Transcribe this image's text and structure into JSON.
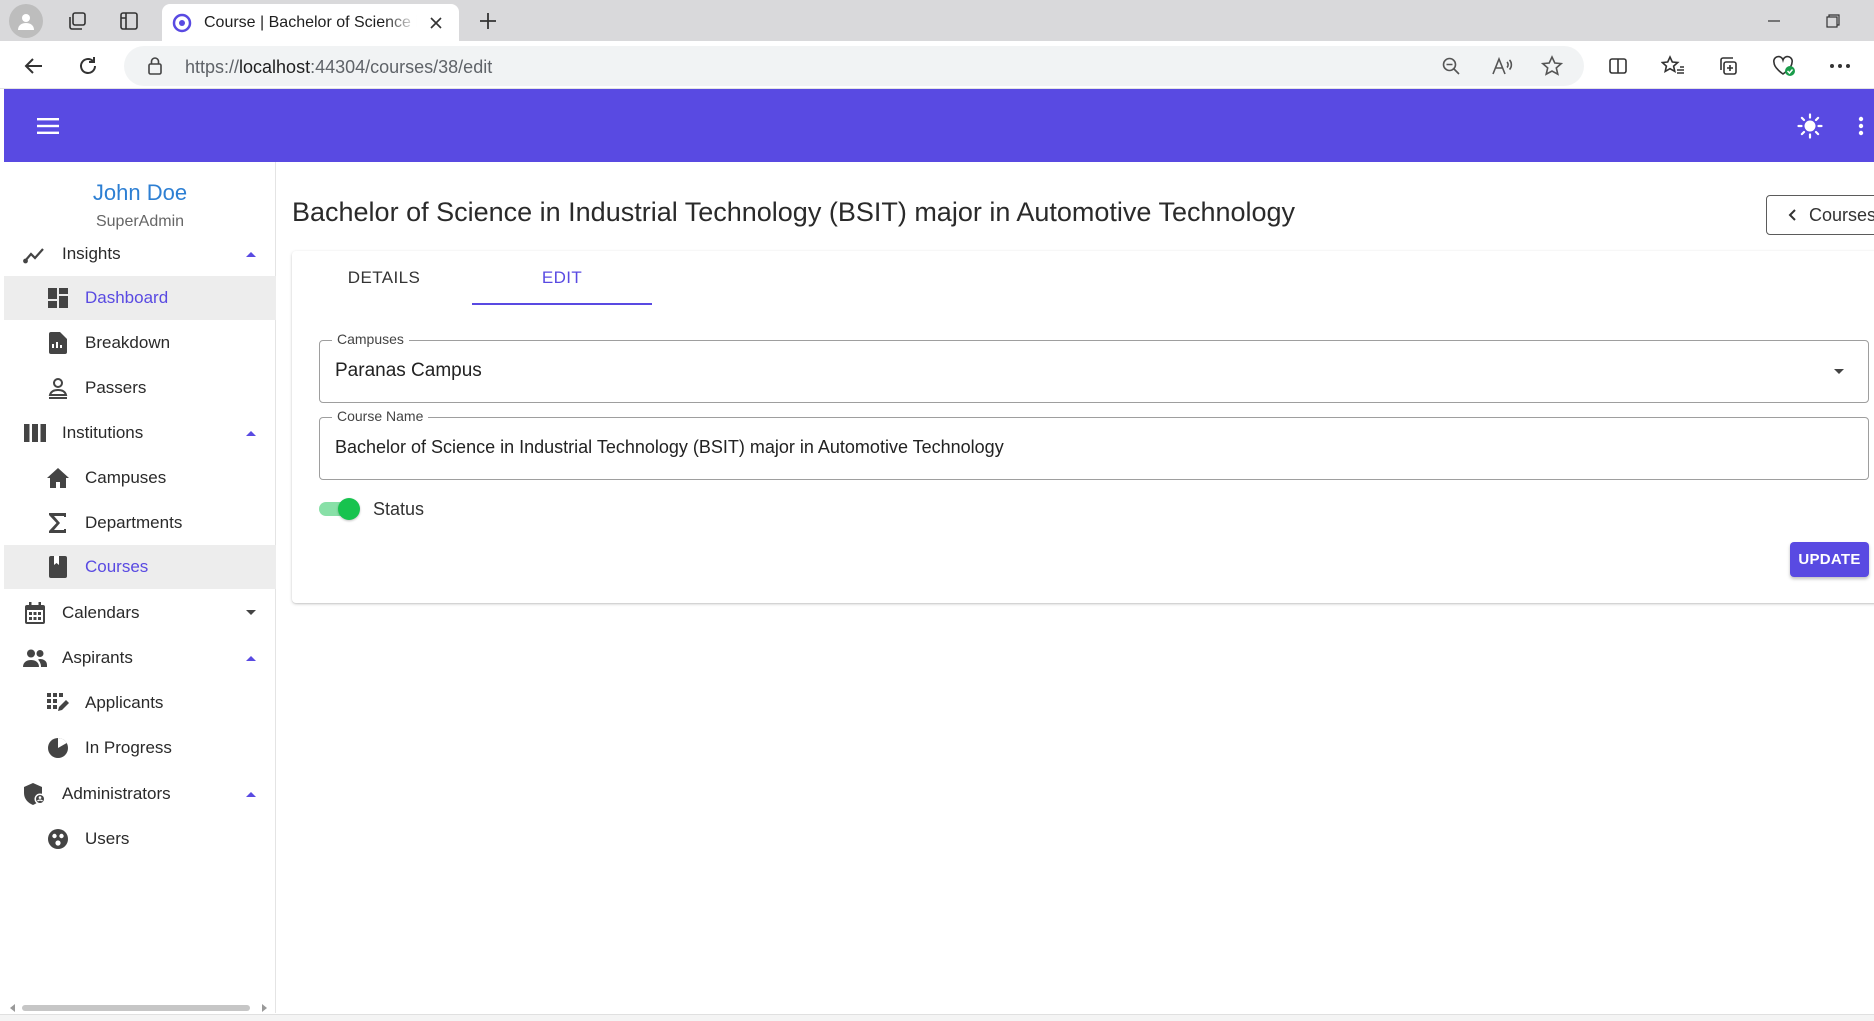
{
  "browser": {
    "tab_title": "Course | Bachelor of Science in Industrial Technology (BSIT) major in Automotive Technology",
    "url_scheme": "https://",
    "url_host": "localhost",
    "url_rest": ":44304/courses/38/edit"
  },
  "app": {
    "accent_color": "#594ae2",
    "user": {
      "name": "John Doe",
      "role": "SuperAdmin"
    },
    "nav": {
      "insights": "Insights",
      "dashboard": "Dashboard",
      "breakdown": "Breakdown",
      "passers": "Passers",
      "institutions": "Institutions",
      "campuses": "Campuses",
      "departments": "Departments",
      "courses": "Courses",
      "calendars": "Calendars",
      "aspirants": "Aspirants",
      "applicants": "Applicants",
      "in_progress": "In Progress",
      "administrators": "Administrators",
      "users": "Users"
    },
    "page": {
      "title": "Bachelor of Science in Industrial Technology (BSIT) major in Automotive Technology",
      "back_button": "Courses",
      "tabs": {
        "details": "DETAILS",
        "edit": "EDIT"
      },
      "form": {
        "campus_label": "Campuses",
        "campus_value": "Paranas Campus",
        "course_name_label": "Course Name",
        "course_name_value": "Bachelor of Science in Industrial Technology (BSIT) major in Automotive Technology",
        "status_label": "Status",
        "status_on": true,
        "update_button": "UPDATE"
      }
    }
  }
}
